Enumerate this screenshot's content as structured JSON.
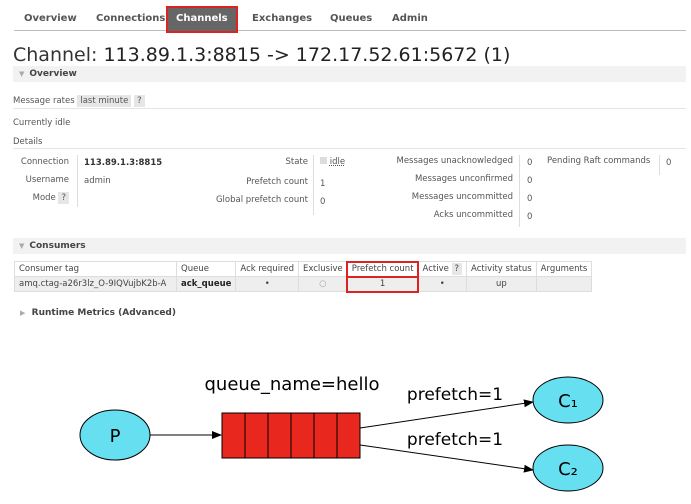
{
  "nav": {
    "tabs": [
      "Overview",
      "Connections",
      "Channels",
      "Exchanges",
      "Queues",
      "Admin"
    ],
    "active": "Channels"
  },
  "title": {
    "prefix": "Channel:",
    "value": "113.89.1.3:8815 -> 172.17.52.61:5672 (1)"
  },
  "overview": {
    "label": "Overview",
    "message_rates_label": "Message rates",
    "rate_option": "last minute",
    "help": "?",
    "status": "Currently idle",
    "details_label": "Details"
  },
  "details": {
    "connection_label": "Connection",
    "connection": "113.89.1.3:8815",
    "username_label": "Username",
    "username": "admin",
    "mode_label": "Mode",
    "mode_help": "?",
    "state_label": "State",
    "state": "idle",
    "prefetch_label": "Prefetch count",
    "prefetch": "1",
    "global_prefetch_label": "Global prefetch count",
    "global_prefetch": "0",
    "unacked_label": "Messages unacknowledged",
    "unacked": "0",
    "unconfirmed_label": "Messages unconfirmed",
    "unconfirmed": "0",
    "uncommitted_label": "Messages uncommitted",
    "uncommitted": "0",
    "acks_uncommitted_label": "Acks uncommitted",
    "acks_uncommitted": "0",
    "raft_label": "Pending Raft commands",
    "raft": "0"
  },
  "consumers": {
    "label": "Consumers",
    "headers": [
      "Consumer tag",
      "Queue",
      "Ack required",
      "Exclusive",
      "Prefetch count",
      "Active",
      "?",
      "Activity status",
      "Arguments"
    ],
    "row": {
      "tag": "amq.ctag-a26r3lz_O-9IQVujbK2b-A",
      "queue": "ack_queue",
      "ack": "•",
      "exclusive": "○",
      "prefetch": "1",
      "active": "•",
      "status": "up",
      "args": ""
    }
  },
  "runtime": {
    "label": "Runtime Metrics (Advanced)"
  },
  "diagram": {
    "producer": "P",
    "queue_label": "queue_name=hello",
    "edge1": "prefetch=1",
    "edge2": "prefetch=1",
    "c1": "C₁",
    "c2": "C₂",
    "colors": {
      "node": "#66e0f0",
      "queue": "#e8281e"
    }
  }
}
